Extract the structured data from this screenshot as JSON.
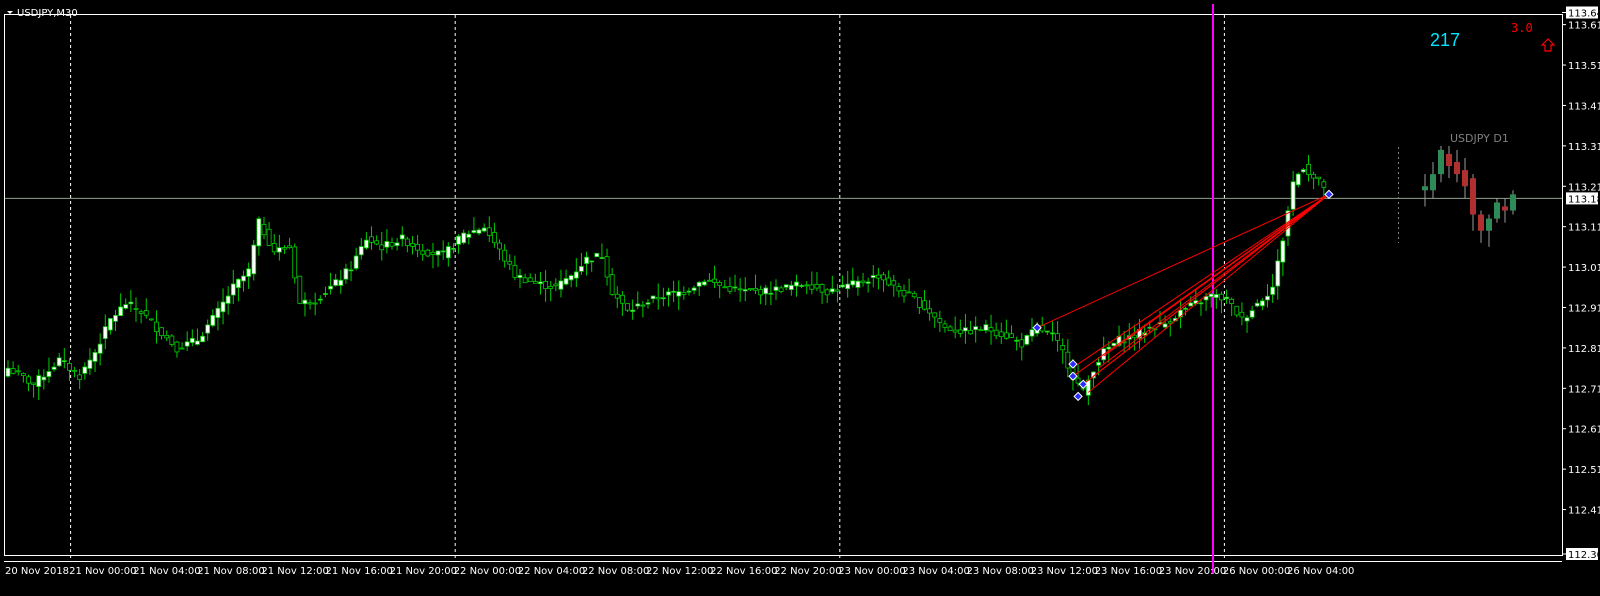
{
  "window": {
    "symbol_label": "USDJPY,M30"
  },
  "overlay": {
    "counter": "217",
    "spread_value": "3.0",
    "arrow_icon": "up-arrow-outline-icon",
    "mini_chart_label": "USDJPY D1"
  },
  "colors": {
    "background": "#000000",
    "axis_text": "#ffffff",
    "bull_body": "#ffffff",
    "bear_body": "#000000",
    "wick": "#00cc00",
    "bid_line": "#8fa08f",
    "magenta_line": "#ff00ff",
    "trend_lines": "#ff0000",
    "counter_color": "#00e5ff",
    "spread_color": "#ff0000",
    "mini_bull": "#2e8b57",
    "mini_bear": "#b03030",
    "mini_label": "#808080"
  },
  "chart_data": {
    "type": "candlestick",
    "symbol": "USDJPY",
    "timeframe": "M30",
    "ylim": [
      112.3,
      113.64
    ],
    "y_ticks": [
      "113.64",
      "113.61",
      "113.51",
      "113.41",
      "113.31",
      "113.21",
      "113.11",
      "113.01",
      "112.91",
      "112.81",
      "112.71",
      "112.61",
      "112.51",
      "112.41",
      "112.30"
    ],
    "current_price": "113.18",
    "x_labels": [
      "20 Nov 2018",
      "21 Nov 00:00",
      "21 Nov 04:00",
      "21 Nov 08:00",
      "21 Nov 12:00",
      "21 Nov 16:00",
      "21 Nov 20:00",
      "22 Nov 00:00",
      "22 Nov 04:00",
      "22 Nov 08:00",
      "22 Nov 12:00",
      "22 Nov 16:00",
      "22 Nov 20:00",
      "23 Nov 00:00",
      "23 Nov 04:00",
      "23 Nov 08:00",
      "23 Nov 12:00",
      "23 Nov 16:00",
      "23 Nov 20:00",
      "26 Nov 00:00",
      "26 Nov 04:00"
    ],
    "day_separators": [
      "21 Nov 00:00",
      "22 Nov 00:00",
      "23 Nov 00:00",
      "26 Nov 00:00"
    ],
    "close_path": [
      [
        0,
        112.76
      ],
      [
        5,
        112.72
      ],
      [
        10,
        112.78
      ],
      [
        14,
        112.74
      ],
      [
        17,
        112.8
      ],
      [
        20,
        112.88
      ],
      [
        23,
        112.92
      ],
      [
        26,
        112.9
      ],
      [
        29,
        112.86
      ],
      [
        33,
        112.81
      ],
      [
        37,
        112.83
      ],
      [
        41,
        112.9
      ],
      [
        44,
        112.96
      ],
      [
        47,
        113.0
      ],
      [
        49,
        113.12
      ],
      [
        52,
        113.05
      ],
      [
        55,
        113.06
      ],
      [
        57,
        112.92
      ],
      [
        60,
        112.93
      ],
      [
        64,
        112.97
      ],
      [
        67,
        113.01
      ],
      [
        70,
        113.08
      ],
      [
        73,
        113.06
      ],
      [
        77,
        113.08
      ],
      [
        81,
        113.05
      ],
      [
        85,
        113.04
      ],
      [
        89,
        113.09
      ],
      [
        93,
        113.11
      ],
      [
        96,
        113.05
      ],
      [
        99,
        112.99
      ],
      [
        103,
        112.97
      ],
      [
        107,
        112.96
      ],
      [
        110,
        112.99
      ],
      [
        113,
        113.03
      ],
      [
        116,
        113.04
      ],
      [
        118,
        112.95
      ],
      [
        121,
        112.9
      ],
      [
        124,
        112.92
      ],
      [
        128,
        112.94
      ],
      [
        132,
        112.95
      ],
      [
        136,
        112.98
      ],
      [
        140,
        112.96
      ],
      [
        144,
        112.95
      ],
      [
        148,
        112.95
      ],
      [
        152,
        112.96
      ],
      [
        156,
        112.97
      ],
      [
        160,
        112.95
      ],
      [
        163,
        112.96
      ],
      [
        166,
        112.97
      ],
      [
        170,
        112.99
      ],
      [
        173,
        112.96
      ],
      [
        177,
        112.93
      ],
      [
        180,
        112.9
      ],
      [
        183,
        112.86
      ],
      [
        187,
        112.85
      ],
      [
        191,
        112.86
      ],
      [
        195,
        112.84
      ],
      [
        198,
        112.82
      ],
      [
        201,
        112.86
      ],
      [
        204,
        112.84
      ],
      [
        206,
        112.8
      ],
      [
        208,
        112.74
      ],
      [
        210,
        112.7
      ],
      [
        212,
        112.76
      ],
      [
        214,
        112.8
      ],
      [
        217,
        112.83
      ],
      [
        220,
        112.84
      ],
      [
        223,
        112.86
      ],
      [
        226,
        112.87
      ],
      [
        229,
        112.9
      ],
      [
        232,
        112.92
      ],
      [
        235,
        112.94
      ],
      [
        238,
        112.93
      ],
      [
        241,
        112.88
      ],
      [
        244,
        112.92
      ],
      [
        247,
        112.96
      ],
      [
        249,
        113.08
      ],
      [
        251,
        113.22
      ],
      [
        253,
        113.26
      ],
      [
        255,
        113.23
      ],
      [
        257,
        113.21
      ]
    ],
    "trend_lines": [
      {
        "from": [
          201,
          112.86
        ],
        "to": [
          258,
          113.19
        ]
      },
      {
        "from": [
          208,
          112.74
        ],
        "to": [
          258,
          113.19
        ]
      },
      {
        "from": [
          209,
          112.77
        ],
        "to": [
          258,
          113.19
        ]
      },
      {
        "from": [
          210,
          112.72
        ],
        "to": [
          258,
          113.19
        ]
      },
      {
        "from": [
          211,
          112.7
        ],
        "to": [
          258,
          113.19
        ]
      },
      {
        "from": [
          212,
          112.74
        ],
        "to": [
          258,
          113.19
        ]
      },
      {
        "from": [
          213,
          112.76
        ],
        "to": [
          258,
          113.19
        ]
      },
      {
        "from": [
          214,
          112.79
        ],
        "to": [
          258,
          113.19
        ]
      }
    ],
    "markers": [
      [
        201,
        112.86
      ],
      [
        208,
        112.77
      ],
      [
        208,
        112.74
      ],
      [
        210,
        112.72
      ],
      [
        209,
        112.69
      ],
      [
        258,
        113.19
      ]
    ],
    "mini_d1": [
      {
        "o": 113.2,
        "c": 113.21,
        "h": 113.24,
        "l": 113.16
      },
      {
        "o": 113.2,
        "c": 113.24,
        "h": 113.27,
        "l": 113.18
      },
      {
        "o": 113.24,
        "c": 113.3,
        "h": 113.31,
        "l": 113.22
      },
      {
        "o": 113.29,
        "c": 113.26,
        "h": 113.31,
        "l": 113.23
      },
      {
        "o": 113.27,
        "c": 113.24,
        "h": 113.3,
        "l": 113.22
      },
      {
        "o": 113.25,
        "c": 113.21,
        "h": 113.28,
        "l": 113.18
      },
      {
        "o": 113.23,
        "c": 113.14,
        "h": 113.24,
        "l": 113.1
      },
      {
        "o": 113.14,
        "c": 113.1,
        "h": 113.15,
        "l": 113.07
      },
      {
        "o": 113.1,
        "c": 113.13,
        "h": 113.14,
        "l": 113.06
      },
      {
        "o": 113.13,
        "c": 113.17,
        "h": 113.18,
        "l": 113.12
      },
      {
        "o": 113.16,
        "c": 113.15,
        "h": 113.18,
        "l": 113.12
      },
      {
        "o": 113.15,
        "c": 113.19,
        "h": 113.2,
        "l": 113.14
      }
    ]
  }
}
